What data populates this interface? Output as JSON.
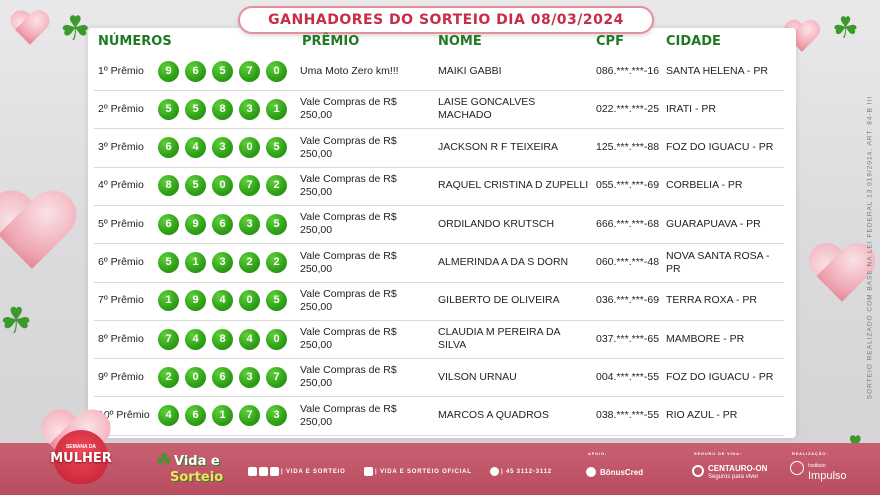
{
  "title": "GANHADORES DO SORTEIO DIA  08/03/2024",
  "headers": {
    "numeros": "NÚMEROS",
    "premio": "PRÊMIO",
    "nome": "NOME",
    "cpf": "CPF",
    "cidade": "CIDADE"
  },
  "rows": [
    {
      "prize": "1º Prêmio",
      "balls": [
        "9",
        "6",
        "5",
        "7",
        "0"
      ],
      "premio": "Uma Moto Zero km!!!",
      "nome": "MAIKI GABBI",
      "cpf": "086.***.***-16",
      "cidade": "SANTA HELENA - PR"
    },
    {
      "prize": "2º Prêmio",
      "balls": [
        "5",
        "5",
        "8",
        "3",
        "1"
      ],
      "premio": "Vale Compras de R$ 250,00",
      "nome": "LAISE GONCALVES MACHADO",
      "cpf": "022.***.***-25",
      "cidade": "IRATI - PR"
    },
    {
      "prize": "3º Prêmio",
      "balls": [
        "6",
        "4",
        "3",
        "0",
        "5"
      ],
      "premio": "Vale Compras de R$ 250,00",
      "nome": "JACKSON R F TEIXEIRA",
      "cpf": "125.***.***-88",
      "cidade": "FOZ DO IGUACU - PR"
    },
    {
      "prize": "4º Prêmio",
      "balls": [
        "8",
        "5",
        "0",
        "7",
        "2"
      ],
      "premio": "Vale Compras de R$ 250,00",
      "nome": "RAQUEL CRISTINA D ZUPELLI",
      "cpf": "055.***.***-69",
      "cidade": "CORBELIA - PR"
    },
    {
      "prize": "5º Prêmio",
      "balls": [
        "6",
        "9",
        "6",
        "3",
        "5"
      ],
      "premio": "Vale Compras de R$ 250,00",
      "nome": "ORDILANDO KRUTSCH",
      "cpf": "666.***.***-68",
      "cidade": "GUARAPUAVA - PR"
    },
    {
      "prize": "6º Prêmio",
      "balls": [
        "5",
        "1",
        "3",
        "2",
        "2"
      ],
      "premio": "Vale Compras de R$ 250,00",
      "nome": "ALMERINDA A DA S DORN",
      "cpf": "060.***.***-48",
      "cidade": "NOVA SANTA ROSA - PR"
    },
    {
      "prize": "7º Prêmio",
      "balls": [
        "1",
        "9",
        "4",
        "0",
        "5"
      ],
      "premio": "Vale Compras de R$ 250,00",
      "nome": "GILBERTO DE OLIVEIRA",
      "cpf": "036.***.***-69",
      "cidade": "TERRA ROXA - PR"
    },
    {
      "prize": "8º Prêmio",
      "balls": [
        "7",
        "4",
        "8",
        "4",
        "0"
      ],
      "premio": "Vale Compras de R$ 250,00",
      "nome": "CLAUDIA M PEREIRA DA SILVA",
      "cpf": "037.***.***-65",
      "cidade": "MAMBORE - PR"
    },
    {
      "prize": "9º Prêmio",
      "balls": [
        "2",
        "0",
        "6",
        "3",
        "7"
      ],
      "premio": "Vale Compras de R$ 250,00",
      "nome": "VILSON URNAU",
      "cpf": "004.***.***-55",
      "cidade": "FOZ DO IGUACU - PR"
    },
    {
      "prize": "10º Prêmio",
      "balls": [
        "4",
        "6",
        "1",
        "7",
        "3"
      ],
      "premio": "Vale Compras de R$ 250,00",
      "nome": "MARCOS A QUADROS",
      "cpf": "038.***.***-55",
      "cidade": "RIO AZUL - PR"
    }
  ],
  "legal_text": "SORTEIO REALIZADO COM BASE NA LEI FEDERAL 13.019/2014, ART. 84-B III",
  "footer": {
    "mulher_small": "SEMANA DA",
    "mulher_big": "MULHER",
    "vida_line1": "Vida e",
    "vida_line2": "Sorteio",
    "social1": "| VIDA E SORTEIO",
    "social2": "| VIDA E SORTEIO OFICIAL",
    "phone": "| 45 3112-3112",
    "apoio_label": "APOIO:",
    "bonus": "BônusCred",
    "seguro_label": "SEGURO DE VIDA:",
    "centauro": "CENTAURO-ON",
    "centauro_sub": "Seguros para viver",
    "realizacao_label": "REALIZAÇÃO:",
    "impulso_small": "Instituto",
    "impulso": "Impulso"
  },
  "colors": {
    "accent_green": "#1e7a22",
    "ball_green": "#2ea016",
    "title_red": "#c72d45",
    "footer_pink": "#c25a6a"
  }
}
